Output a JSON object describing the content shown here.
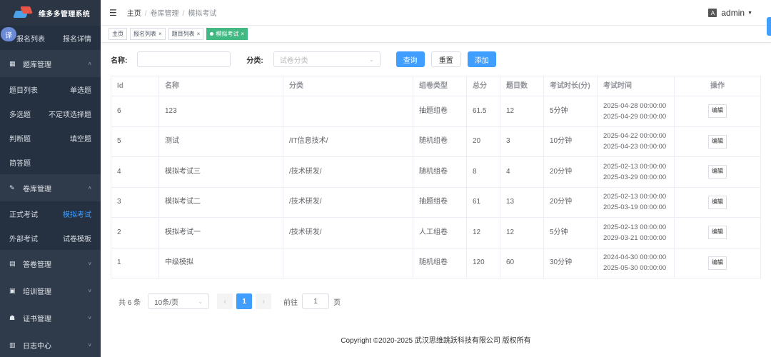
{
  "app": {
    "title": "维多多管理系统"
  },
  "translate_label": "译",
  "sidebar": {
    "top_row": {
      "left": "报名列表",
      "right": "报名详情"
    },
    "groups": [
      {
        "icon": "grid-icon",
        "label": "题库管理",
        "expanded": true,
        "rows": [
          {
            "left": "题目列表",
            "right": "单选题"
          },
          {
            "left": "多选题",
            "right": "不定项选择题"
          },
          {
            "left": "判断题",
            "right": "填空题"
          },
          {
            "left": "简答题",
            "right": ""
          }
        ]
      },
      {
        "icon": "pin-icon",
        "label": "卷库管理",
        "expanded": true,
        "rows": [
          {
            "left": "正式考试",
            "right": "模拟考试"
          },
          {
            "left": "外部考试",
            "right": "试卷模板"
          }
        ]
      },
      {
        "icon": "book-icon",
        "label": "答卷管理",
        "expanded": false
      },
      {
        "icon": "training-icon",
        "label": "培训管理",
        "expanded": false
      },
      {
        "icon": "certificate-icon",
        "label": "证书管理",
        "expanded": false
      },
      {
        "icon": "log-icon",
        "label": "日志中心",
        "expanded": false
      }
    ]
  },
  "header": {
    "breadcrumb": [
      "主页",
      "卷库管理",
      "模拟考试"
    ],
    "user": "admin"
  },
  "tags": [
    {
      "label": "主页",
      "closable": false,
      "active": false
    },
    {
      "label": "报名列表",
      "closable": true,
      "active": false
    },
    {
      "label": "题目列表",
      "closable": true,
      "active": false
    },
    {
      "label": "模拟考试",
      "closable": true,
      "active": true
    }
  ],
  "search": {
    "name_label": "名称:",
    "category_label": "分类:",
    "category_placeholder": "试卷分类",
    "query_btn": "查询",
    "reset_btn": "重置",
    "add_btn": "添加"
  },
  "table": {
    "columns": [
      "Id",
      "名称",
      "分类",
      "组卷类型",
      "总分",
      "题目数",
      "考试时长(分)",
      "考试时间",
      "操作"
    ],
    "edit_label": "编辑",
    "rows": [
      {
        "id": "6",
        "name": "123",
        "category": "",
        "type": "抽题组卷",
        "score": "61.5",
        "count": "12",
        "duration": "5分钟",
        "start": "2025-04-28 00:00:00",
        "end": "2025-04-29 00:00:00"
      },
      {
        "id": "5",
        "name": "测试",
        "category": "/IT信息技术/",
        "type": "随机组卷",
        "score": "20",
        "count": "3",
        "duration": "10分钟",
        "start": "2025-04-22 00:00:00",
        "end": "2025-04-23 00:00:00"
      },
      {
        "id": "4",
        "name": "模拟考试三",
        "category": "/技术研发/",
        "type": "随机组卷",
        "score": "8",
        "count": "4",
        "duration": "20分钟",
        "start": "2025-02-13 00:00:00",
        "end": "2025-03-29 00:00:00"
      },
      {
        "id": "3",
        "name": "模拟考试二",
        "category": "/技术研发/",
        "type": "抽题组卷",
        "score": "61",
        "count": "13",
        "duration": "20分钟",
        "start": "2025-02-13 00:00:00",
        "end": "2025-03-19 00:00:00"
      },
      {
        "id": "2",
        "name": "模拟考试一",
        "category": "/技术研发/",
        "type": "人工组卷",
        "score": "12",
        "count": "12",
        "duration": "5分钟",
        "start": "2025-02-13 00:00:00",
        "end": "2029-03-21 00:00:00"
      },
      {
        "id": "1",
        "name": "中级模拟",
        "category": "",
        "type": "随机组卷",
        "score": "120",
        "count": "60",
        "duration": "30分钟",
        "start": "2024-04-30 00:00:00",
        "end": "2025-05-30 00:00:00"
      }
    ]
  },
  "pager": {
    "total": "共 6 条",
    "page_size": "10条/页",
    "current": "1",
    "goto_prefix": "前往",
    "goto_value": "1",
    "goto_suffix": "页"
  },
  "footer": {
    "copyright": "Copyright ©2020-2025 武汉思维跳跃科技有限公司 版权所有"
  },
  "colors": {
    "sidebar_bg": "#2f3a4a",
    "primary": "#409eff",
    "active_tag": "#42b983"
  }
}
